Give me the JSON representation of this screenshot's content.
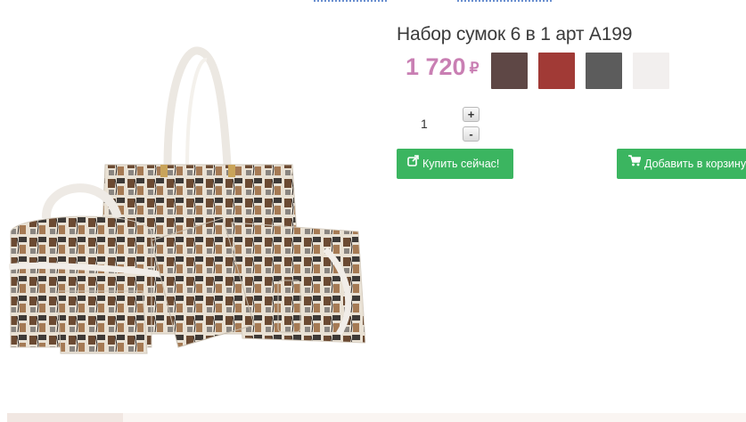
{
  "product": {
    "title": "Набор сумок 6 в 1 арт A199",
    "price": "1 720",
    "currency": "₽",
    "image_alt": "Набор сумок 6 в 1"
  },
  "swatches": [
    {
      "color": "#5e4745",
      "name": "dark-brown"
    },
    {
      "color": "#a13a36",
      "name": "red"
    },
    {
      "color": "#5c5c5c",
      "name": "gray"
    },
    {
      "color": "#f2efee",
      "name": "white"
    }
  ],
  "quantity": {
    "value": "1",
    "plus_label": "+",
    "minus_label": "-"
  },
  "actions": {
    "buy_now_label": "Купить сейчас!",
    "buy_now_icon": "external-link-icon",
    "add_to_cart_label": "Добавить в корзину",
    "add_to_cart_icon": "shopping-cart-icon"
  },
  "colors": {
    "accent_green": "#3bb560",
    "price_pink": "#c97fb3"
  }
}
